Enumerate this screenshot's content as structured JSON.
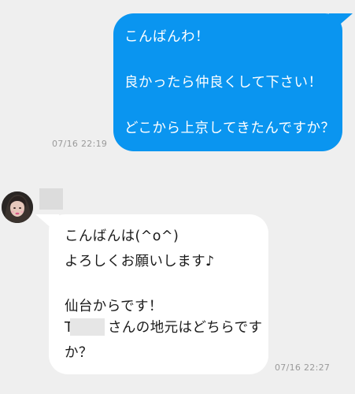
{
  "messages": {
    "outgoing": {
      "line1": "こんばんわ！",
      "line2": "良かったら仲良くして下さい！",
      "line3": "どこから上京してきたんですか？",
      "timestamp": "07/16 22:19"
    },
    "incoming": {
      "line1": "こんばんは(^o^)",
      "line2": "よろしくお願いします♪",
      "line3": "仙台からです！",
      "line4": "さんの地元はどちらです",
      "line4_prefix": "T",
      "line5": "か？",
      "timestamp": "07/16 22:27"
    }
  },
  "colors": {
    "outgoing_bubble": "#0a95f0",
    "incoming_bubble": "#ffffff",
    "background": "#efefef"
  }
}
